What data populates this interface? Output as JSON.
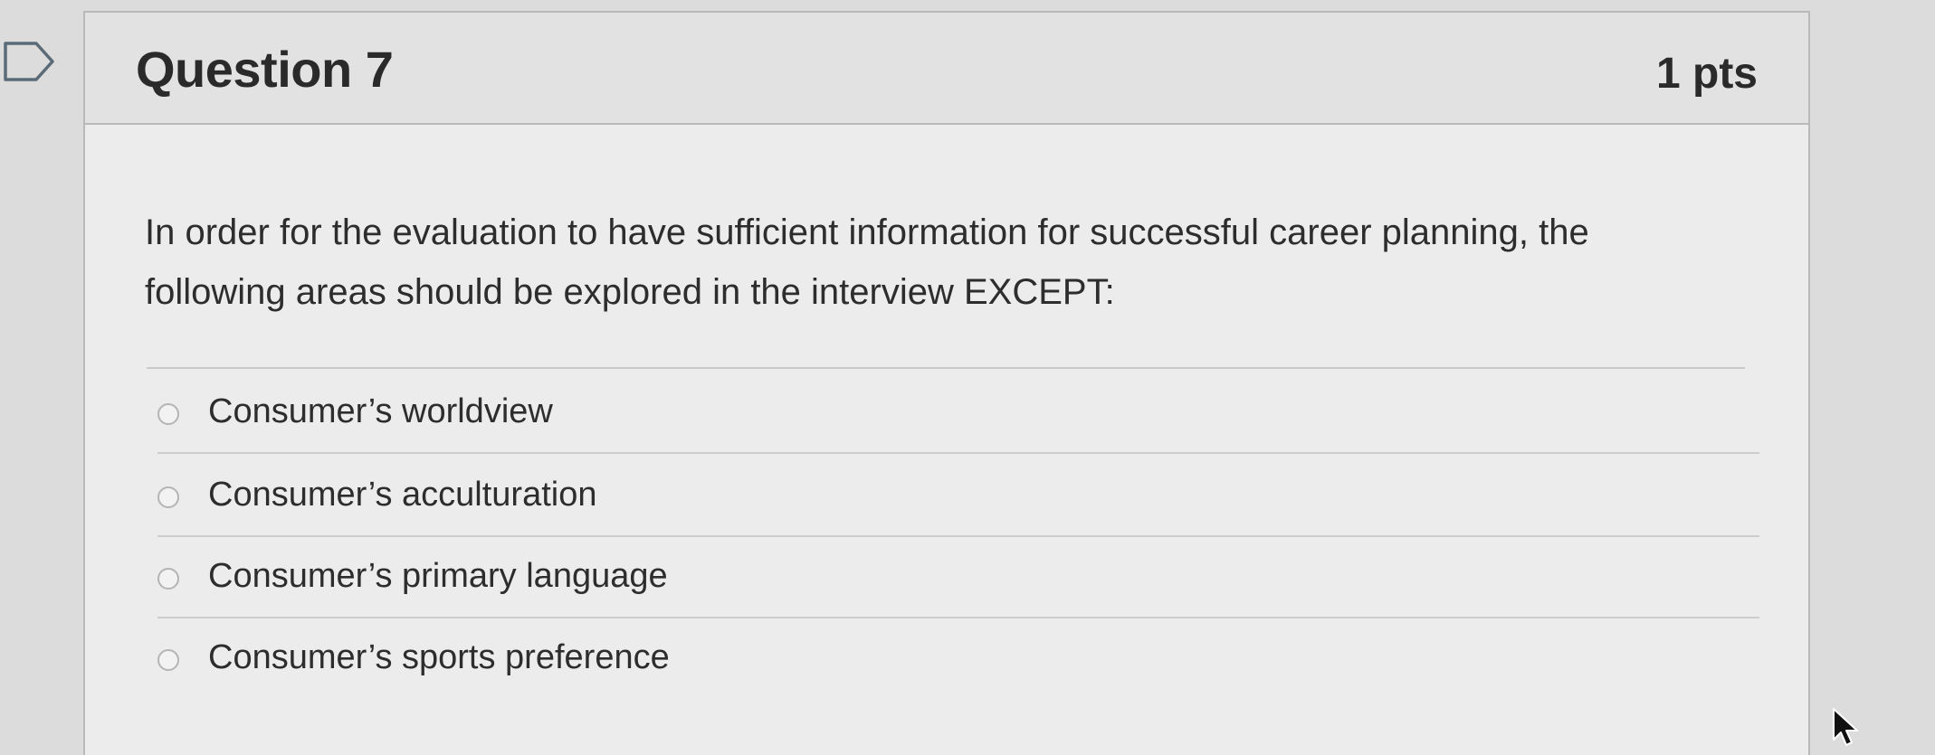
{
  "question": {
    "title": "Question 7",
    "points": "1 pts",
    "text": "In order for the evaluation to have sufficient information for successful career planning, the following areas should be explored in the interview EXCEPT:"
  },
  "answers": [
    {
      "label": "Consumer’s worldview",
      "selected": false
    },
    {
      "label": "Consumer’s acculturation",
      "selected": false
    },
    {
      "label": "Consumer’s primary language",
      "selected": false
    },
    {
      "label": "Consumer’s sports preference",
      "selected": false
    }
  ],
  "icons": {
    "flag": "flag-icon",
    "cursor": "mouse-pointer-icon",
    "radio": "radio-button-icon"
  }
}
